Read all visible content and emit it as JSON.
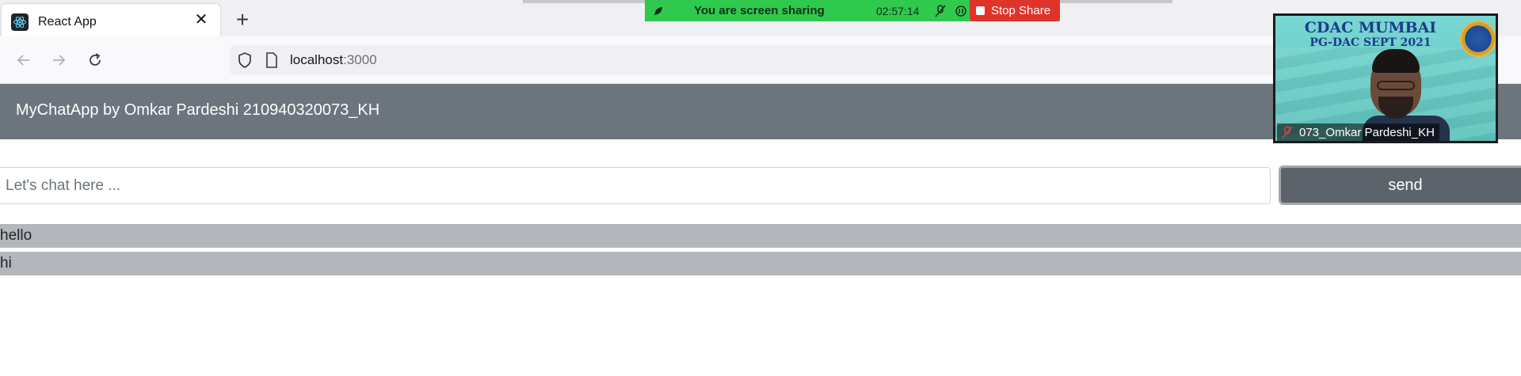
{
  "browser": {
    "tab": {
      "title": "React App",
      "close_glyph": "✕",
      "favicon": "react-icon"
    },
    "new_tab_glyph": "+",
    "url": {
      "host": "localhost",
      "port": ":3000"
    }
  },
  "screen_share": {
    "message": "You are screen sharing",
    "timer": "02:57:14",
    "stop_label": "Stop Share"
  },
  "app": {
    "title": "MyChatApp by Omkar Pardeshi 210940320073_KH",
    "input_placeholder": "Let's chat here ...",
    "send_label": "send",
    "messages": [
      "hello",
      "hi"
    ]
  },
  "video": {
    "title": "CDAC MUMBAI",
    "subtitle": "PG-DAC SEPT 2021",
    "participant_name": "073_Omkar Pardeshi_KH"
  },
  "colors": {
    "header": "#6c757d",
    "send_button": "#5c636a",
    "message_bg": "#b3b7bb",
    "share_bar": "#2fc94d",
    "stop_button": "#e0332a"
  }
}
